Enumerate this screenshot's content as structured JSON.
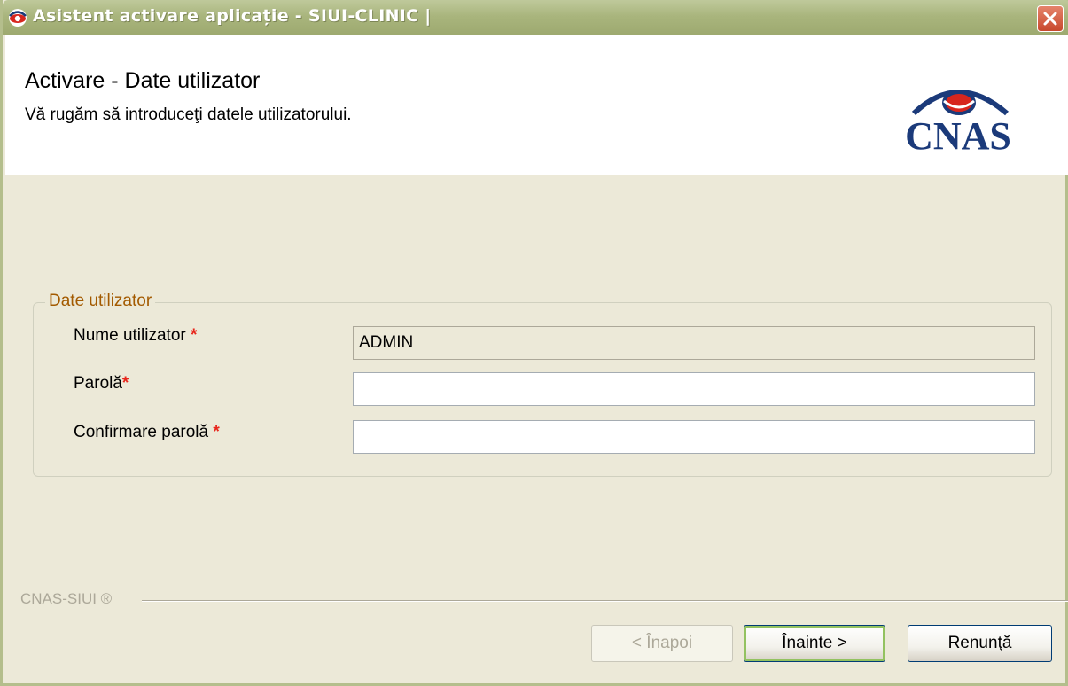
{
  "window": {
    "title": "Asistent activare aplicație - SIUI-CLINIC |"
  },
  "header": {
    "title": "Activare - Date utilizator",
    "subtitle": "Vă rugăm să introduceţi datele utilizatorului.",
    "logo_text": "CNAS"
  },
  "form": {
    "group_label": "Date utilizator",
    "fields": [
      {
        "label": "Nume utilizator",
        "required_mark": "*",
        "value": "ADMIN"
      },
      {
        "label": "Parolă",
        "required_mark": "*",
        "value": ""
      },
      {
        "label": "Confirmare parolă",
        "required_mark": "*",
        "value": ""
      }
    ]
  },
  "footer": {
    "label": "CNAS-SIUI ®"
  },
  "buttons": {
    "back": "< Înapoi",
    "next": "Înainte >",
    "cancel": "Renunţă"
  },
  "colors": {
    "title_bar": "#A9B57D",
    "background": "#ECE9D8",
    "group_label": "#A35A00",
    "required": "#E8261C",
    "close_button": "#C8492D",
    "logo": "#1B3A7A"
  },
  "icons": {
    "app": "cnas-eye-icon",
    "close": "close-x-icon"
  }
}
